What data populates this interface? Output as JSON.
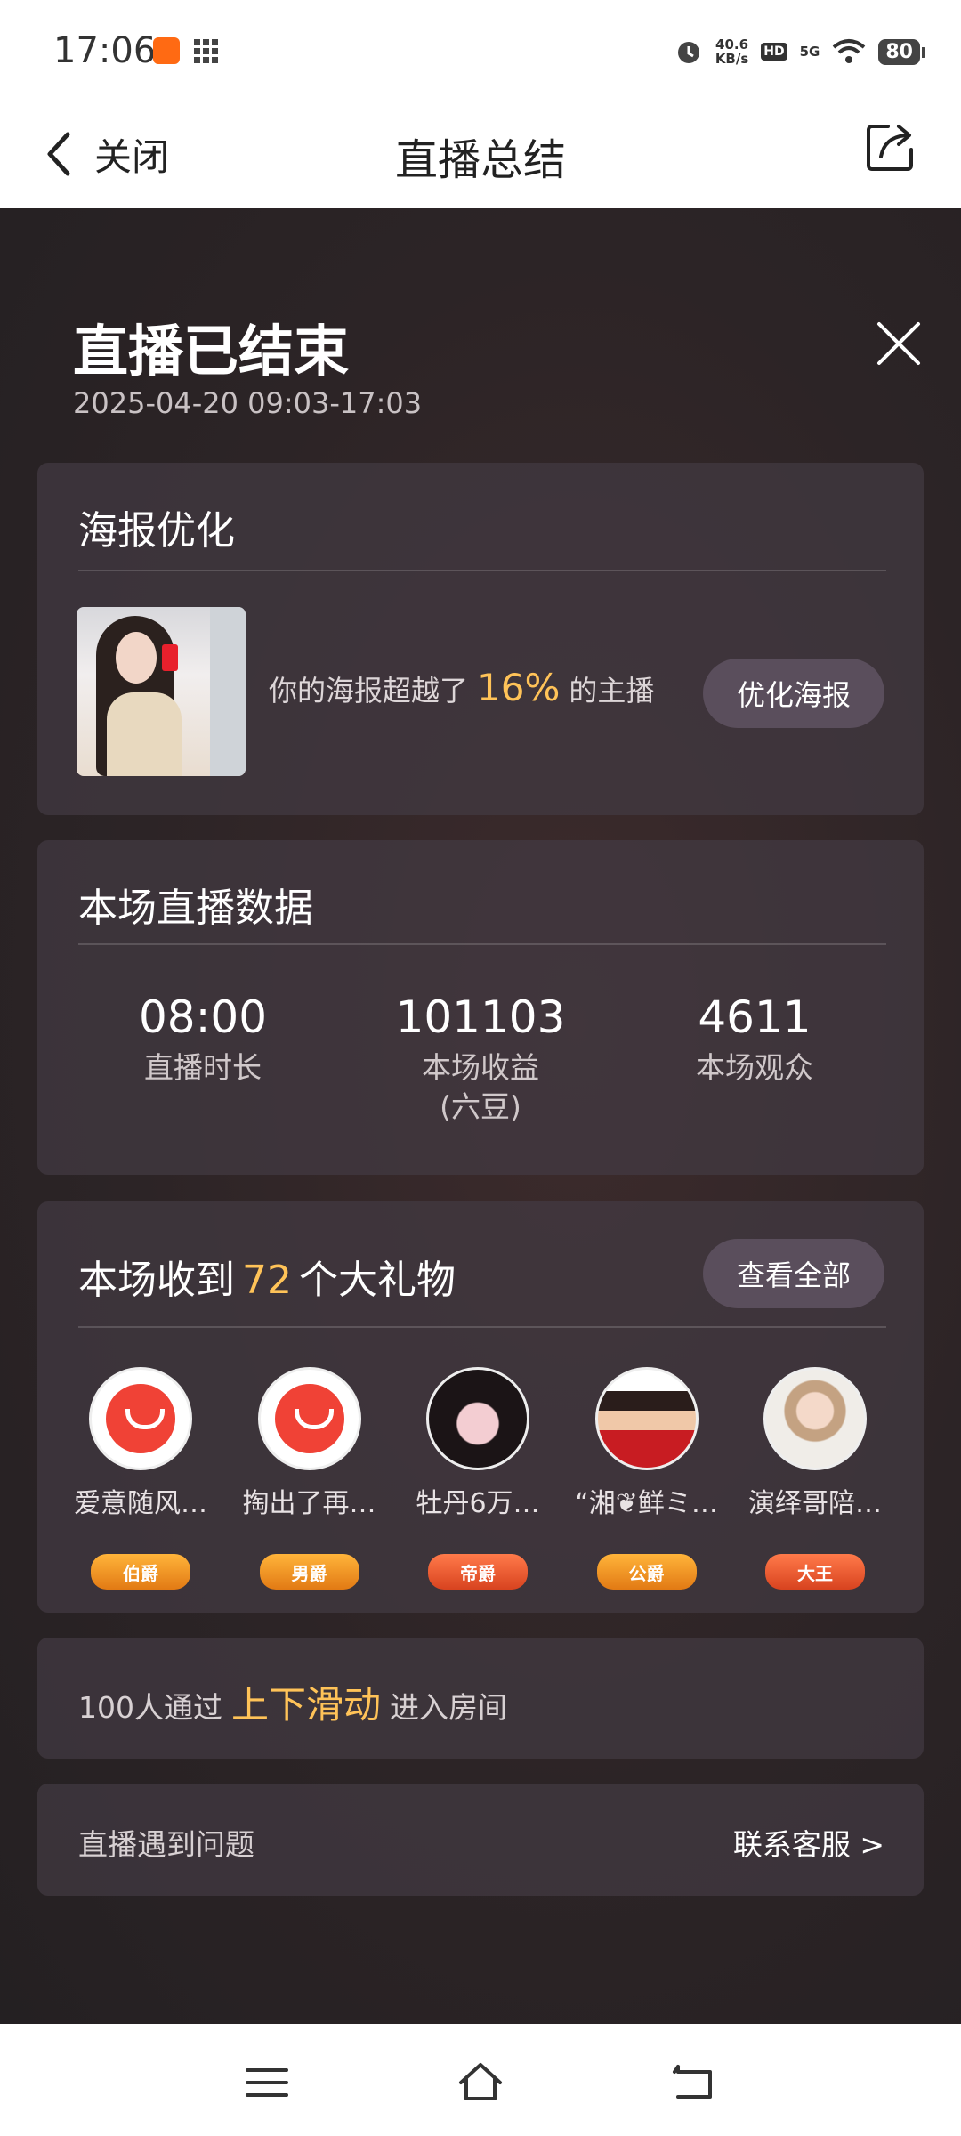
{
  "status_bar": {
    "time": "17:06",
    "net_speed_value": "40.6",
    "net_speed_unit": "KB/s",
    "hd": "HD",
    "network": "5G",
    "battery": "80"
  },
  "header": {
    "back_label": "关闭",
    "title": "直播总结"
  },
  "summary": {
    "title": "直播已结束",
    "time_range": "2025-04-20 09:03-17:03"
  },
  "poster": {
    "title": "海报优化",
    "text_before": "你的海报超越了",
    "percent": "16%",
    "text_after": "的主播",
    "button": "优化海报"
  },
  "stats": {
    "title": "本场直播数据",
    "items": [
      {
        "value": "08:00",
        "label": "直播时长",
        "sub": ""
      },
      {
        "value": "101103",
        "label": "本场收益",
        "sub": "(六豆)"
      },
      {
        "value": "4611",
        "label": "本场观众",
        "sub": ""
      }
    ]
  },
  "gifts": {
    "title_before": "本场收到",
    "count": "72",
    "title_after": "个大礼物",
    "view_all": "查看全部",
    "gifters": [
      {
        "name": "爱意随风…",
        "badge": "伯爵",
        "avatar": "default-avatar-icon"
      },
      {
        "name": "掏出了再…",
        "badge": "男爵",
        "avatar": "default-avatar-icon"
      },
      {
        "name": "牡丹6万…",
        "badge": "帝爵",
        "avatar": "photo"
      },
      {
        "name": "“湘❦鲜ミ…",
        "badge": "公爵",
        "avatar": "photo"
      },
      {
        "name": "演绎哥陪…",
        "badge": "大王",
        "avatar": "photo"
      }
    ]
  },
  "slide": {
    "before": "100人通过",
    "highlight": "上下滑动",
    "after": "进入房间"
  },
  "help": {
    "text": "直播遇到问题",
    "link": "联系客服 >"
  },
  "colors": {
    "accent": "#ffc358",
    "card": "#423a42",
    "button": "#5a4e5c"
  }
}
